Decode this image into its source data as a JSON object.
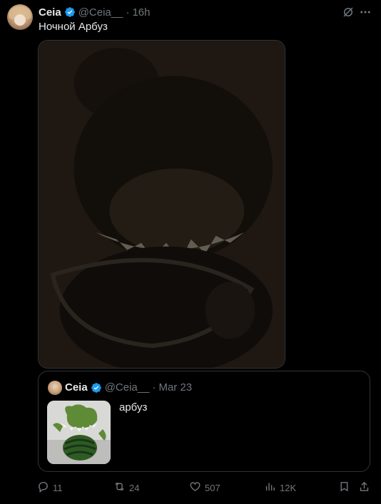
{
  "post": {
    "author_name": "Ceia",
    "handle": "@Ceia__",
    "separator": "·",
    "time": "16h",
    "text": "Ночной Арбуз"
  },
  "quote": {
    "author_name": "Ceia",
    "handle": "@Ceia__",
    "separator": "·",
    "time": "Mar 23",
    "text": "арбуз"
  },
  "actions": {
    "replies": "11",
    "reposts": "24",
    "likes": "507",
    "views": "12K"
  },
  "colors": {
    "verified": "#1d9bf0",
    "secondary_text": "#71767b",
    "primary_text": "#e7e9ea",
    "border": "#2f3336"
  },
  "icons": [
    "verified-badge-icon",
    "grok-icon",
    "more-icon",
    "reply-icon",
    "repost-icon",
    "like-icon",
    "views-icon",
    "bookmark-icon",
    "share-icon"
  ]
}
